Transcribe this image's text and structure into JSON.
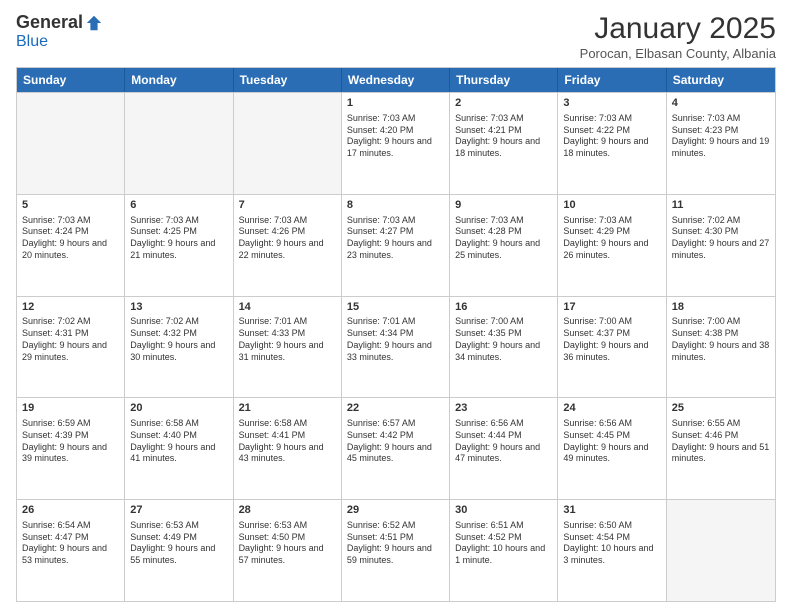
{
  "logo": {
    "general": "General",
    "blue": "Blue"
  },
  "header": {
    "month": "January 2025",
    "location": "Porocan, Elbasan County, Albania"
  },
  "weekdays": [
    "Sunday",
    "Monday",
    "Tuesday",
    "Wednesday",
    "Thursday",
    "Friday",
    "Saturday"
  ],
  "weeks": [
    [
      {
        "day": "",
        "empty": true
      },
      {
        "day": "",
        "empty": true
      },
      {
        "day": "",
        "empty": true
      },
      {
        "day": "1",
        "sunrise": "7:03 AM",
        "sunset": "4:20 PM",
        "daylight": "9 hours and 17 minutes."
      },
      {
        "day": "2",
        "sunrise": "7:03 AM",
        "sunset": "4:21 PM",
        "daylight": "9 hours and 18 minutes."
      },
      {
        "day": "3",
        "sunrise": "7:03 AM",
        "sunset": "4:22 PM",
        "daylight": "9 hours and 18 minutes."
      },
      {
        "day": "4",
        "sunrise": "7:03 AM",
        "sunset": "4:23 PM",
        "daylight": "9 hours and 19 minutes."
      }
    ],
    [
      {
        "day": "5",
        "sunrise": "7:03 AM",
        "sunset": "4:24 PM",
        "daylight": "9 hours and 20 minutes."
      },
      {
        "day": "6",
        "sunrise": "7:03 AM",
        "sunset": "4:25 PM",
        "daylight": "9 hours and 21 minutes."
      },
      {
        "day": "7",
        "sunrise": "7:03 AM",
        "sunset": "4:26 PM",
        "daylight": "9 hours and 22 minutes."
      },
      {
        "day": "8",
        "sunrise": "7:03 AM",
        "sunset": "4:27 PM",
        "daylight": "9 hours and 23 minutes."
      },
      {
        "day": "9",
        "sunrise": "7:03 AM",
        "sunset": "4:28 PM",
        "daylight": "9 hours and 25 minutes."
      },
      {
        "day": "10",
        "sunrise": "7:03 AM",
        "sunset": "4:29 PM",
        "daylight": "9 hours and 26 minutes."
      },
      {
        "day": "11",
        "sunrise": "7:02 AM",
        "sunset": "4:30 PM",
        "daylight": "9 hours and 27 minutes."
      }
    ],
    [
      {
        "day": "12",
        "sunrise": "7:02 AM",
        "sunset": "4:31 PM",
        "daylight": "9 hours and 29 minutes."
      },
      {
        "day": "13",
        "sunrise": "7:02 AM",
        "sunset": "4:32 PM",
        "daylight": "9 hours and 30 minutes."
      },
      {
        "day": "14",
        "sunrise": "7:01 AM",
        "sunset": "4:33 PM",
        "daylight": "9 hours and 31 minutes."
      },
      {
        "day": "15",
        "sunrise": "7:01 AM",
        "sunset": "4:34 PM",
        "daylight": "9 hours and 33 minutes."
      },
      {
        "day": "16",
        "sunrise": "7:00 AM",
        "sunset": "4:35 PM",
        "daylight": "9 hours and 34 minutes."
      },
      {
        "day": "17",
        "sunrise": "7:00 AM",
        "sunset": "4:37 PM",
        "daylight": "9 hours and 36 minutes."
      },
      {
        "day": "18",
        "sunrise": "7:00 AM",
        "sunset": "4:38 PM",
        "daylight": "9 hours and 38 minutes."
      }
    ],
    [
      {
        "day": "19",
        "sunrise": "6:59 AM",
        "sunset": "4:39 PM",
        "daylight": "9 hours and 39 minutes."
      },
      {
        "day": "20",
        "sunrise": "6:58 AM",
        "sunset": "4:40 PM",
        "daylight": "9 hours and 41 minutes."
      },
      {
        "day": "21",
        "sunrise": "6:58 AM",
        "sunset": "4:41 PM",
        "daylight": "9 hours and 43 minutes."
      },
      {
        "day": "22",
        "sunrise": "6:57 AM",
        "sunset": "4:42 PM",
        "daylight": "9 hours and 45 minutes."
      },
      {
        "day": "23",
        "sunrise": "6:56 AM",
        "sunset": "4:44 PM",
        "daylight": "9 hours and 47 minutes."
      },
      {
        "day": "24",
        "sunrise": "6:56 AM",
        "sunset": "4:45 PM",
        "daylight": "9 hours and 49 minutes."
      },
      {
        "day": "25",
        "sunrise": "6:55 AM",
        "sunset": "4:46 PM",
        "daylight": "9 hours and 51 minutes."
      }
    ],
    [
      {
        "day": "26",
        "sunrise": "6:54 AM",
        "sunset": "4:47 PM",
        "daylight": "9 hours and 53 minutes."
      },
      {
        "day": "27",
        "sunrise": "6:53 AM",
        "sunset": "4:49 PM",
        "daylight": "9 hours and 55 minutes."
      },
      {
        "day": "28",
        "sunrise": "6:53 AM",
        "sunset": "4:50 PM",
        "daylight": "9 hours and 57 minutes."
      },
      {
        "day": "29",
        "sunrise": "6:52 AM",
        "sunset": "4:51 PM",
        "daylight": "9 hours and 59 minutes."
      },
      {
        "day": "30",
        "sunrise": "6:51 AM",
        "sunset": "4:52 PM",
        "daylight": "10 hours and 1 minute."
      },
      {
        "day": "31",
        "sunrise": "6:50 AM",
        "sunset": "4:54 PM",
        "daylight": "10 hours and 3 minutes."
      },
      {
        "day": "",
        "empty": true
      }
    ]
  ]
}
